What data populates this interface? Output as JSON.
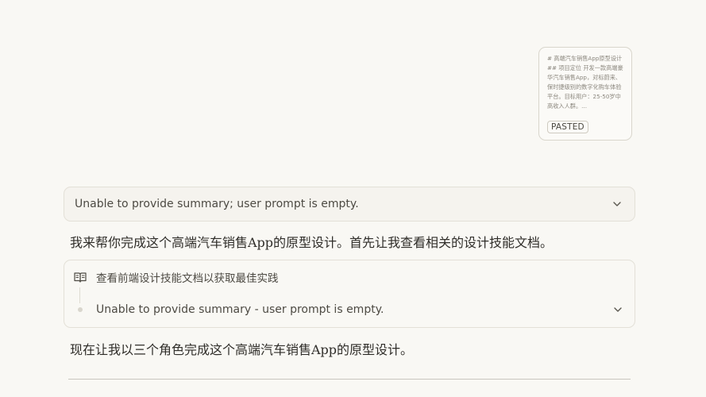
{
  "pasted": {
    "preview": "# 高端汽车销售App原型设计 ## 项目定位 开发一款高端豪华汽车销售App，对标蔚来、保时捷级别的数字化购车体验平台。目标用户：25-50岁中高收入人群。...",
    "badge": "PASTED"
  },
  "summary_block": {
    "text": "Unable to provide summary; user prompt is empty."
  },
  "messages": {
    "first": "我来帮你完成这个高端汽车销售App的原型设计。首先让我查看相关的设计技能文档。",
    "second": "现在让我以三个角色完成这个高端汽车销售App的原型设计。"
  },
  "tool_block": {
    "icon": "book-open-icon",
    "label": "查看前端设计技能文档以获取最佳实践",
    "summary": "Unable to provide summary - user prompt is empty."
  }
}
